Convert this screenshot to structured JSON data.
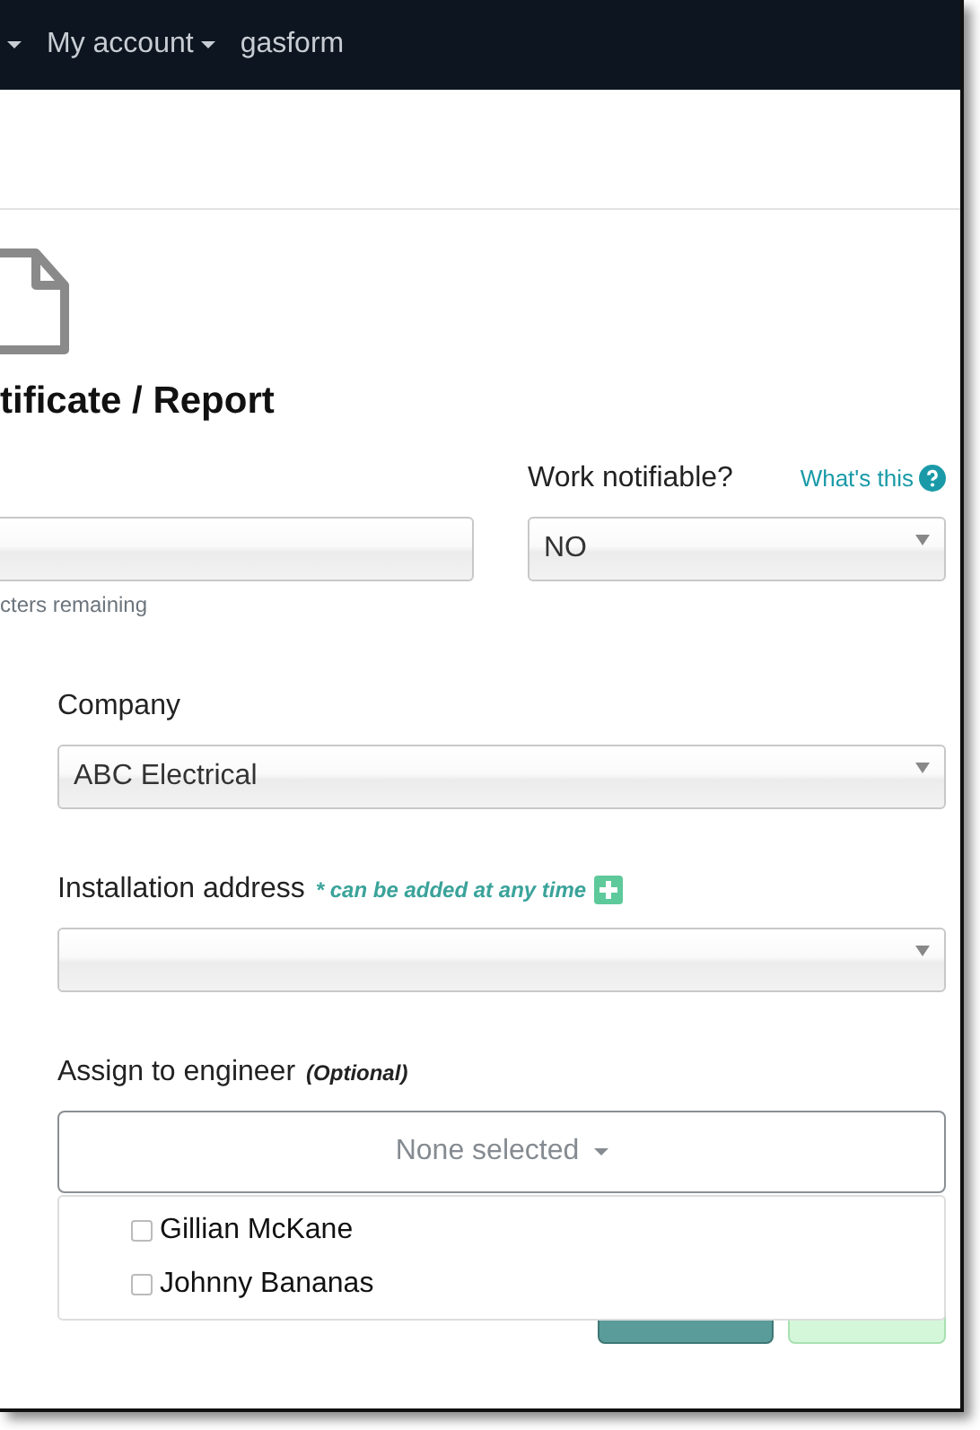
{
  "nav": {
    "items": [
      {
        "label": "My account",
        "dropdown": true
      },
      {
        "label": "gasform",
        "dropdown": false
      }
    ]
  },
  "title": "tificate / Report",
  "left_field": {
    "hint": "cters remaining"
  },
  "work_notifiable": {
    "label": "Work notifiable?",
    "help_link": "What's this",
    "value": "NO"
  },
  "company": {
    "label": "Company",
    "value": "ABC Electrical"
  },
  "installation_address": {
    "label": "Installation address",
    "note": "* can be added at any time"
  },
  "engineer": {
    "label": "Assign to engineer",
    "note": "(Optional)",
    "button": "None selected",
    "expanded": true,
    "options": [
      {
        "label": "Gillian McKane",
        "checked": false
      },
      {
        "label": "Johnny Bananas",
        "checked": false
      }
    ]
  },
  "actions": [
    {
      "kind": "secondary"
    },
    {
      "kind": "primary"
    }
  ]
}
